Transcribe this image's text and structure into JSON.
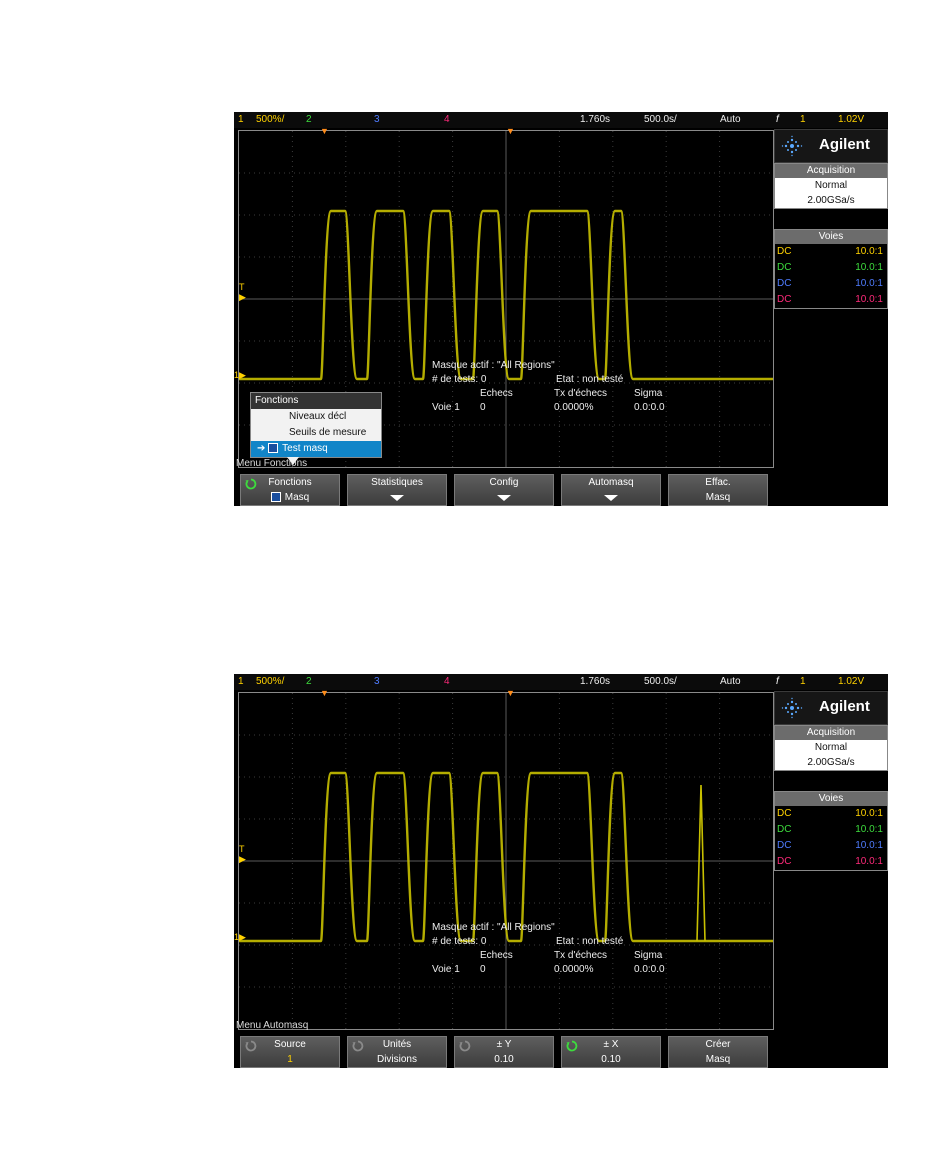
{
  "screens": [
    {
      "topbar": {
        "ch1": "1",
        "ch1_scale": "500%/",
        "ch2": "2",
        "ch3": "3",
        "ch4": "4",
        "delay": "1.760s",
        "timebase": "500.0s/",
        "mode": "Auto",
        "trig_icon": "f",
        "trig_src": "1",
        "trig_level": "1.02V"
      },
      "overlay": {
        "mask_line": "Masque actif : \"All Regions\"",
        "tests": "# de tests: 0",
        "state": "Etat : non testé",
        "col_fail": "Echecs",
        "col_rate": "Tx d'échecs",
        "col_sigma": "Sigma",
        "row_label": "Voie 1",
        "row_fail": "0",
        "row_rate": "0.0000%",
        "row_sigma": "0.0:0.0"
      },
      "menu_title": "Menu Fonctions",
      "popup": {
        "title": "Fonctions",
        "items": [
          "Niveaux décl",
          "Seuils de mesure"
        ],
        "selected": "Test masq"
      },
      "softkeys": [
        {
          "l1": "Fonctions",
          "l2": "Masq",
          "knob": true,
          "knob_active": true,
          "check": true
        },
        {
          "l1": "Statistiques",
          "l2": "",
          "arrow": true
        },
        {
          "l1": "Config",
          "l2": "",
          "arrow": true
        },
        {
          "l1": "Automasq",
          "l2": "",
          "arrow": true
        },
        {
          "l1": "Effac.",
          "l2": "Masq"
        }
      ],
      "glitch": false
    },
    {
      "topbar": {
        "ch1": "1",
        "ch1_scale": "500%/",
        "ch2": "2",
        "ch3": "3",
        "ch4": "4",
        "delay": "1.760s",
        "timebase": "500.0s/",
        "mode": "Auto",
        "trig_icon": "f",
        "trig_src": "1",
        "trig_level": "1.02V"
      },
      "overlay": {
        "mask_line": "Masque actif : \"All Regions\"",
        "tests": "# de tests: 0",
        "state": "Etat : non testé",
        "col_fail": "Echecs",
        "col_rate": "Tx d'échecs",
        "col_sigma": "Sigma",
        "row_label": "Voie 1",
        "row_fail": "0",
        "row_rate": "0.0000%",
        "row_sigma": "0.0:0.0"
      },
      "menu_title": "Menu Automasq",
      "softkeys": [
        {
          "l1": "Source",
          "l2": "1",
          "knob": true,
          "knob_active": false,
          "l2color": "#ffd200"
        },
        {
          "l1": "Unités",
          "l2": "Divisions",
          "knob": true,
          "knob_active": false
        },
        {
          "l1": "± Y",
          "l2": "0.10",
          "knob": true,
          "knob_active": false
        },
        {
          "l1": "± X",
          "l2": "0.10",
          "knob": true,
          "knob_active": true
        },
        {
          "l1": "Créer",
          "l2": "Masq"
        }
      ],
      "glitch": true
    }
  ],
  "sidebar": {
    "logo": "Agilent",
    "acq_title": "Acquisition",
    "acq_mode": "Normal",
    "acq_rate": "2.00GSa/s",
    "voies_title": "Voies",
    "channels": [
      {
        "coupling": "DC",
        "probe": "10.0:1",
        "color": "#ffd200"
      },
      {
        "coupling": "DC",
        "probe": "10.0:1",
        "color": "#3ddc3d"
      },
      {
        "coupling": "DC",
        "probe": "10.0:1",
        "color": "#4f7cff"
      },
      {
        "coupling": "DC",
        "probe": "10.0:1",
        "color": "#ff2a7a"
      }
    ]
  },
  "colors": {
    "ch1": "#ffd200",
    "ch2": "#3ddc3d",
    "ch3": "#4f7cff",
    "ch4": "#ff2a7a",
    "trace": "#c8c000",
    "trigger_marker": "#ff8c1a"
  }
}
